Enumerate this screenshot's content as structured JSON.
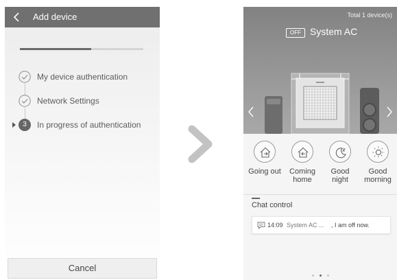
{
  "left": {
    "header": {
      "title": "Add device",
      "color": "#707070"
    },
    "progress": 0.58,
    "steps": [
      {
        "label": "My device authentication",
        "state": "done"
      },
      {
        "label": "Network Settings",
        "state": "done"
      },
      {
        "number": "3",
        "label": "In progress of authentication",
        "state": "current"
      }
    ],
    "cancel_label": "Cancel"
  },
  "right": {
    "total_devices": "Total 1 device(s)",
    "power_badge": "OFF",
    "device_name": "System AC",
    "modes": [
      {
        "icon": "house-out-icon",
        "label": "Going out"
      },
      {
        "icon": "house-in-icon",
        "label": "Coming home"
      },
      {
        "icon": "moon-sleep-icon",
        "label": "Good night"
      },
      {
        "icon": "sun-icon",
        "label": "Good morning"
      }
    ],
    "chat": {
      "title": "Chat control",
      "time": "14:09",
      "device": "System AC ...",
      "text": ", I am off now."
    },
    "page_indicator": {
      "count": 3,
      "active": 2
    }
  }
}
